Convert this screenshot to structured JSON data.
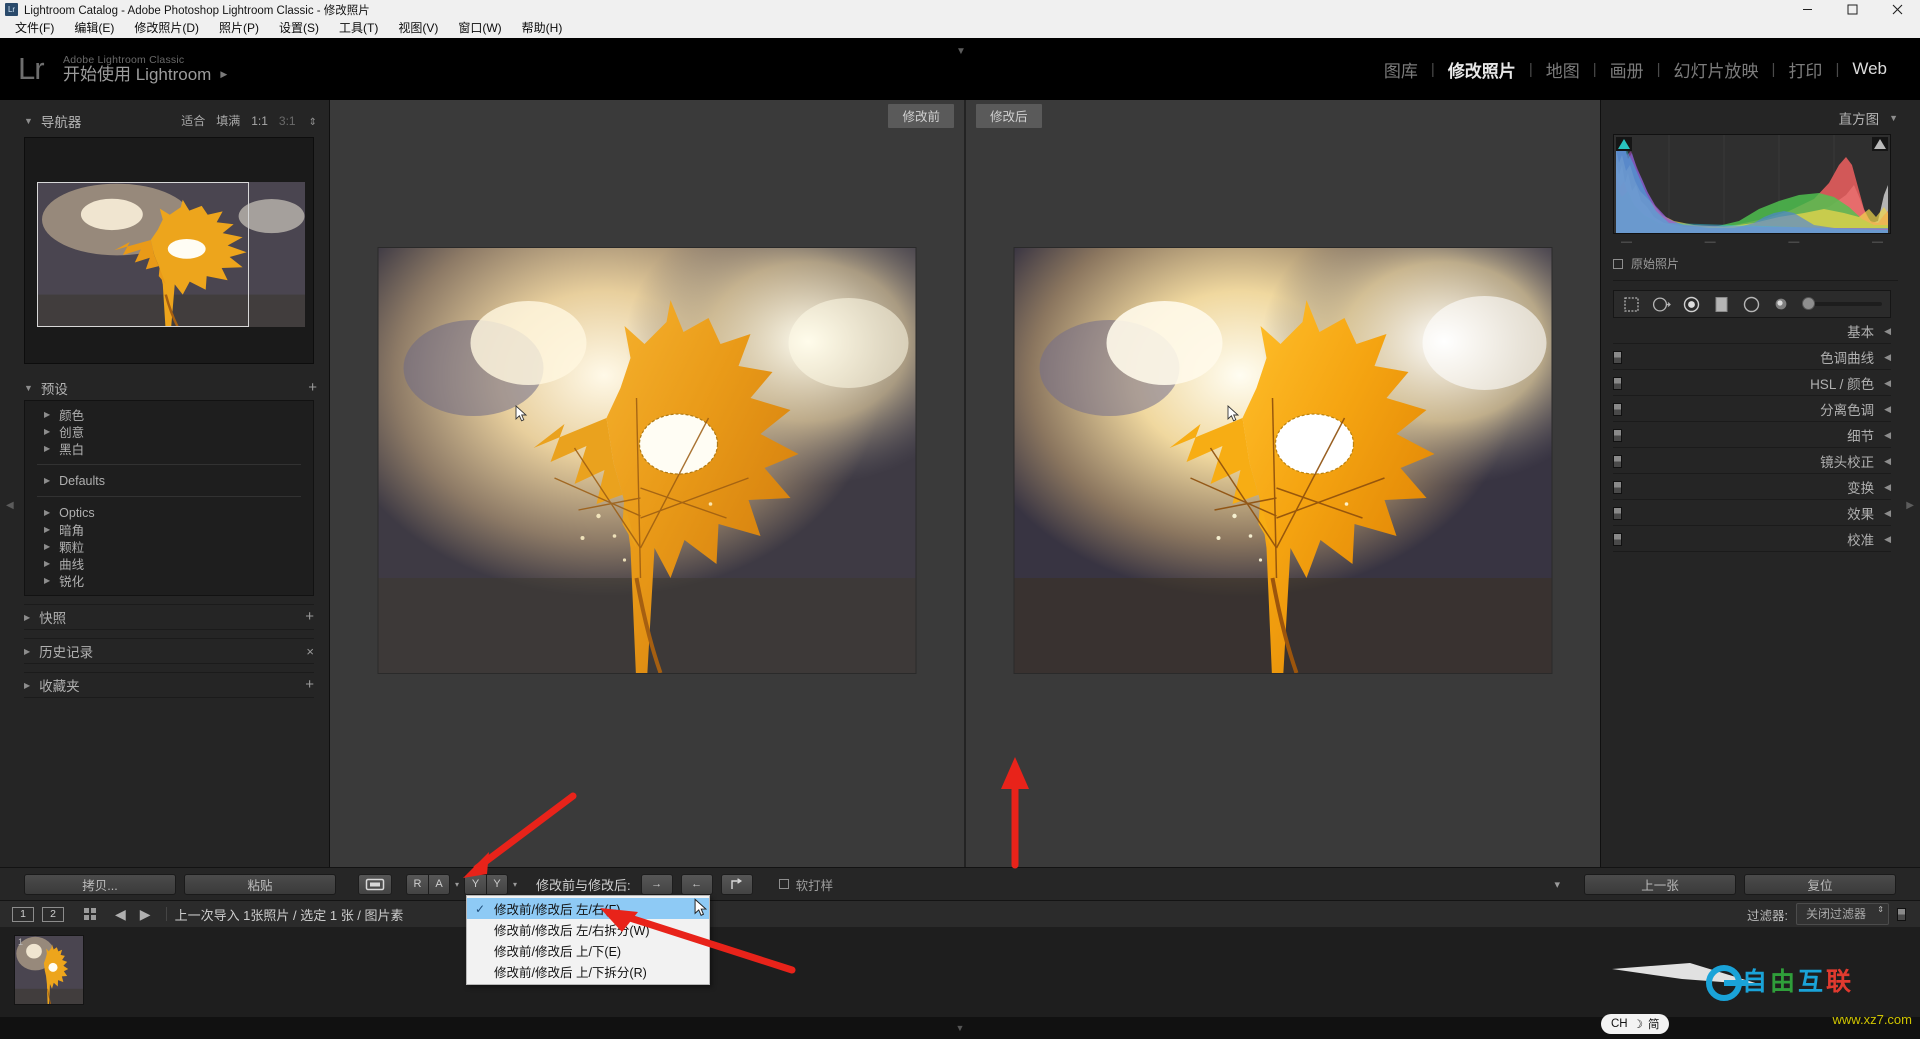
{
  "window": {
    "title": "Lightroom Catalog - Adobe Photoshop Lightroom Classic - 修改照片",
    "icon": "Lr",
    "minimize": "minimize-icon",
    "maximize": "maximize-icon",
    "close": "close-icon"
  },
  "menubar": {
    "items": [
      {
        "label": "文件(F)"
      },
      {
        "label": "编辑(E)"
      },
      {
        "label": "修改照片(D)"
      },
      {
        "label": "照片(P)"
      },
      {
        "label": "设置(S)"
      },
      {
        "label": "工具(T)"
      },
      {
        "label": "视图(V)"
      },
      {
        "label": "窗口(W)"
      },
      {
        "label": "帮助(H)"
      }
    ]
  },
  "identity": {
    "logo": "Lr",
    "sub": "Adobe Lightroom Classic",
    "main": "开始使用 Lightroom",
    "caret": "▶"
  },
  "modules": [
    {
      "label": "图库",
      "active": false
    },
    {
      "label": "修改照片",
      "active": true
    },
    {
      "label": "地图",
      "active": false
    },
    {
      "label": "画册",
      "active": false
    },
    {
      "label": "幻灯片放映",
      "active": false
    },
    {
      "label": "打印",
      "active": false
    },
    {
      "label": "Web",
      "active": false
    }
  ],
  "left_panel": {
    "navigator": {
      "title": "导航器",
      "modes": [
        "适合",
        "填满",
        "1:1",
        "3:1"
      ],
      "active_mode": "1:1",
      "dim_mode": "3:1"
    },
    "presets": {
      "title": "预设",
      "add_label": "+",
      "groups": [
        {
          "label": "颜色"
        },
        {
          "label": "创意"
        },
        {
          "label": "黑白"
        },
        {
          "label": "Defaults",
          "separator_before": true
        },
        {
          "label": "Optics",
          "separator_before": true
        },
        {
          "label": "暗角"
        },
        {
          "label": "颗粒"
        },
        {
          "label": "曲线"
        },
        {
          "label": "锐化"
        }
      ]
    },
    "sections": [
      {
        "label": "快照",
        "action": "+"
      },
      {
        "label": "历史记录",
        "action": "×"
      },
      {
        "label": "收藏夹",
        "action": "+"
      }
    ],
    "buttons": {
      "copy": "拷贝...",
      "paste": "粘贴"
    }
  },
  "right_panel": {
    "histogram": {
      "title": "直方图",
      "original_photo_label": "原始照片",
      "shadow_clip_color": "#29c4c0",
      "highlight_clip_color": "#b9b9b9"
    },
    "tools": [
      {
        "name": "crop-tool"
      },
      {
        "name": "spot-removal-tool"
      },
      {
        "name": "red-eye-tool"
      },
      {
        "name": "graduated-filter-tool"
      },
      {
        "name": "radial-filter-tool"
      },
      {
        "name": "adjustment-brush-tool"
      }
    ],
    "sections": [
      {
        "label": "基本",
        "has_switch": false
      },
      {
        "label": "色调曲线",
        "has_switch": true
      },
      {
        "label": "HSL / 颜色",
        "has_switch": true
      },
      {
        "label": "分离色调",
        "has_switch": true
      },
      {
        "label": "细节",
        "has_switch": true
      },
      {
        "label": "镜头校正",
        "has_switch": true
      },
      {
        "label": "变换",
        "has_switch": true
      },
      {
        "label": "效果",
        "has_switch": true
      },
      {
        "label": "校准",
        "has_switch": true
      }
    ],
    "buttons": {
      "previous": "上一张",
      "reset": "复位"
    }
  },
  "center": {
    "before_label": "修改前",
    "after_label": "修改后"
  },
  "toolbar": {
    "compare_label": "修改前与修改后:",
    "soft_proof_label": "软打样",
    "view_button": "view-loupe-icon",
    "flag_buttons": [
      "R",
      "A"
    ],
    "color_buttons": [
      "Y",
      "Y"
    ],
    "swap_buttons": [
      "→",
      "←",
      "⇥"
    ],
    "right_caret": "▾"
  },
  "filmstrip_bar": {
    "screen1": "1",
    "screen2": "2",
    "text": "上一次导入  1张照片 / 选定 1 张 / 图片素",
    "filter_label": "过滤器:",
    "filter_value": "关闭过滤器"
  },
  "filmstrip": {
    "thumbs": [
      {
        "index": "1"
      }
    ]
  },
  "dropdown": {
    "items": [
      {
        "label": "修改前/修改后 左/右(F)",
        "selected": true
      },
      {
        "label": "修改前/修改后 左/右拆分(W)",
        "selected": false
      },
      {
        "label": "修改前/修改后 上/下(E)",
        "selected": false
      },
      {
        "label": "修改前/修改后 上/下拆分(R)",
        "selected": false
      }
    ]
  },
  "ime": {
    "lang": "CH",
    "moon": "☽",
    "mode": "简"
  },
  "watermark": {
    "text": "自由互联",
    "url": "www.xz7.com"
  },
  "colors": {
    "panel_bg": "#252525",
    "canvas_bg": "#3a3a3a",
    "accent_highlight": "#8ecaf5",
    "annotation_red": "#e8231a"
  }
}
